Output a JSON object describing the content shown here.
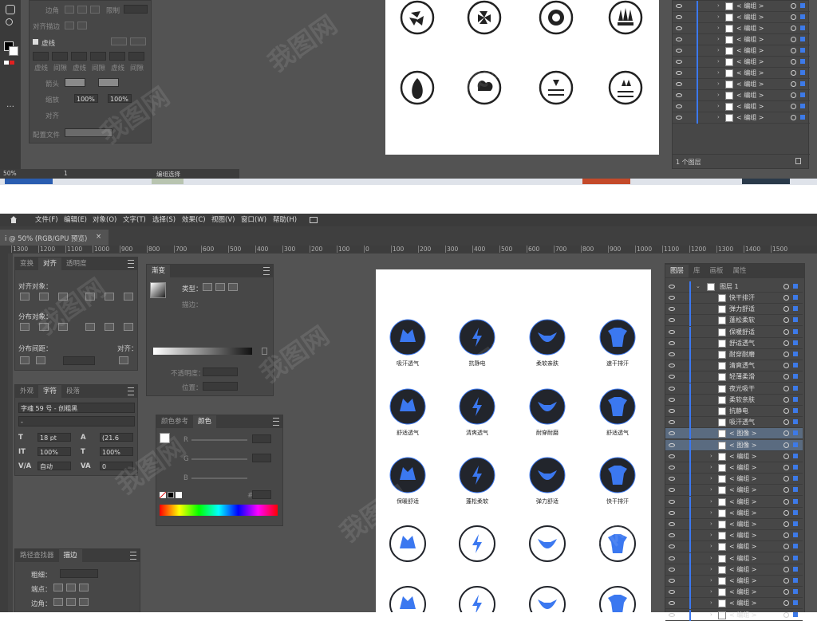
{
  "top": {
    "panel": {
      "labels": [
        "边角",
        "限制",
        "对齐描边",
        "虚线",
        "虚线",
        "间隙",
        "虚线",
        "间隙",
        "虚线",
        "间隙",
        "箭头",
        "缩放",
        "对齐",
        "配置文件"
      ],
      "pct1": "100%",
      "pct2": "100%"
    },
    "status": {
      "zoom": "50%",
      "page": "1",
      "mode": "编组选择"
    },
    "layers_footer": "1 个图层",
    "layers_rows": [
      "< 编组 >",
      "< 编组 >",
      "< 编组 >",
      "< 编组 >",
      "< 编组 >",
      "< 编组 >",
      "< 编组 >",
      "< 编组 >",
      "< 编组 >",
      "< 编组 >",
      "< 编组 >"
    ],
    "icons": [
      "fan-icon",
      "circulation-icon",
      "gear-icon",
      "heat-up-icon",
      "flame-icon",
      "droplet-cloud-icon",
      "water-down-icon",
      "water-up-icon"
    ]
  },
  "menubar": {
    "items": [
      "文件(F)",
      "编辑(E)",
      "对象(O)",
      "文字(T)",
      "选择(S)",
      "效果(C)",
      "视图(V)",
      "窗口(W)",
      "帮助(H)"
    ]
  },
  "doc_tab": {
    "title": "i @ 50% (RGB/GPU 预览)",
    "close": "×"
  },
  "ruler": {
    "marks": [
      "1300",
      "1200",
      "1100",
      "1000",
      "900",
      "800",
      "700",
      "600",
      "500",
      "400",
      "300",
      "200",
      "100",
      "0",
      "100",
      "200",
      "300",
      "400",
      "500",
      "600",
      "700",
      "800",
      "900",
      "1000",
      "1100",
      "1200",
      "1300",
      "1400",
      "1500"
    ]
  },
  "transform_panel": {
    "tabs": [
      "变换",
      "对齐",
      "透明度"
    ],
    "align_objects": "对齐对象：",
    "distribute_objects": "分布对象：",
    "distribute_spacing": "分布间距：",
    "align_to": "对齐："
  },
  "gradient_panel": {
    "tab": "渐变",
    "type_label": "类型：",
    "stroke_label": "描边：",
    "opacity_label": "不透明度：",
    "position_label": "位置："
  },
  "character_panel": {
    "tabs": [
      "外观",
      "字符",
      "段落"
    ],
    "font": "字魂 59 号 - 创粗黑",
    "style": "-",
    "size": "18 pt",
    "leading": "(21.6",
    "hscale": "100%",
    "vscale": "100%",
    "kerning": "自动",
    "tracking": "0"
  },
  "color_panel": {
    "tabs": [
      "颜色参考",
      "颜色"
    ],
    "channels": [
      "R",
      "G",
      "B"
    ],
    "hex_prefix": "#"
  },
  "stroke_panel": {
    "tabs": [
      "路径查找器",
      "描边"
    ],
    "weight": "粗细：",
    "cap": "端点：",
    "corner": "边角："
  },
  "layers_panel": {
    "tabs": [
      "图层",
      "库",
      "画板",
      "属性"
    ],
    "layer_name": "图层 1",
    "rows": [
      "快干排汗",
      "弹力舒适",
      "蓬松柔软",
      "保暖舒适",
      "舒适透气",
      "耐穿耐磨",
      "清爽透气",
      "轻薄柔滑",
      "夜光吸干",
      "柔软亲肤",
      "抗静电",
      "吸汗透气",
      "< 图像 >",
      "< 图像 >",
      "< 编组 >",
      "< 编组 >",
      "< 编组 >",
      "< 编组 >",
      "< 编组 >",
      "< 编组 >",
      "< 编组 >",
      "< 编组 >",
      "< 编组 >",
      "< 编组 >",
      "< 编组 >",
      "< 编组 >",
      "< 编组 >",
      "< 编组 >",
      "< 编组 >"
    ]
  },
  "artboard": {
    "captions_row1": [
      "吸汗透气",
      "抗静电",
      "柔软亲肤",
      "速干排汗"
    ],
    "captions_row2": [
      "舒适透气",
      "清爽透气",
      "耐穿耐磨",
      "舒适透气"
    ],
    "captions_row3": [
      "保暖舒适",
      "蓬松柔软",
      "弹力舒适",
      "快干排汗"
    ],
    "icons_row1": [
      "water-wave-icon",
      "lightning-icon",
      "leaf-icon",
      "shirt-icon"
    ],
    "icons_row2": [
      "fan-icon",
      "circulation-icon",
      "gear-icon",
      "heat-up-icon"
    ],
    "icons_row3": [
      "flame-icon",
      "droplet-cloud-icon",
      "water-down-icon",
      "water-up-icon"
    ]
  },
  "colors": {
    "accent": "#3b78f0",
    "ui_bg": "#535353",
    "panel": "#474747",
    "icon_dark": "#22252c"
  },
  "watermark": "我图网"
}
